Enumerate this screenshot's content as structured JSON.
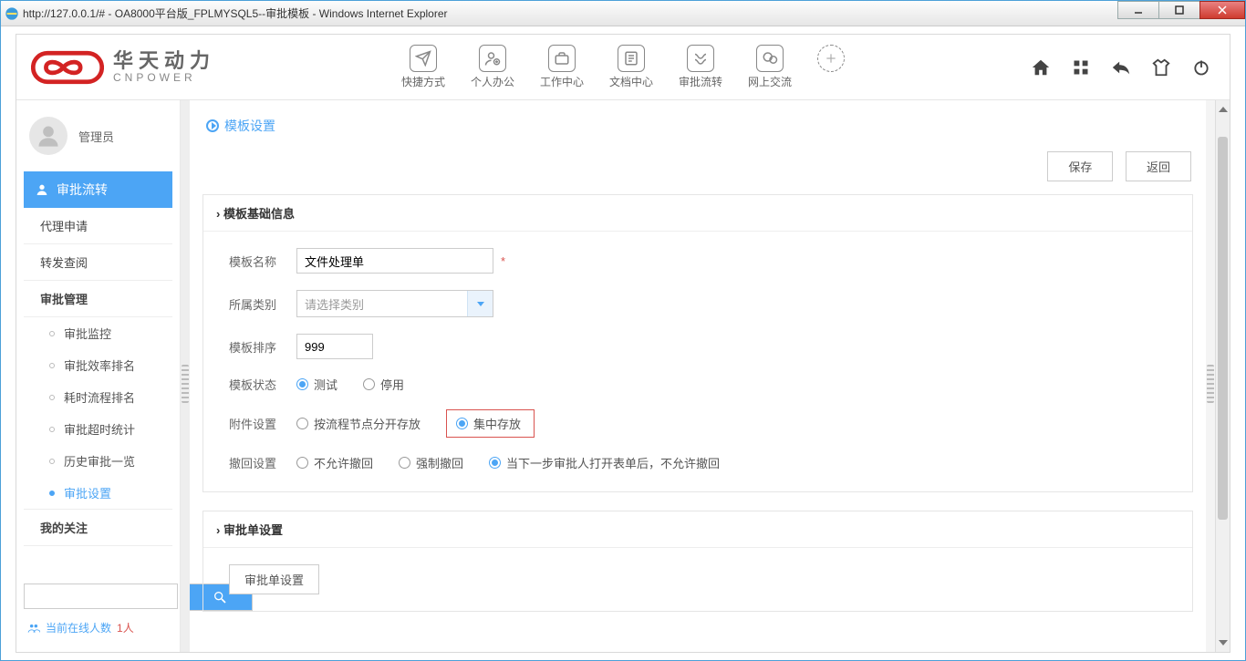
{
  "window": {
    "title": "http://127.0.0.1/# - OA8000平台版_FPLMYSQL5--审批模板 - Windows Internet Explorer"
  },
  "brand": {
    "name_cn": "华天动力",
    "name_en": "CNPOWER"
  },
  "nav_center": [
    {
      "label": "快捷方式"
    },
    {
      "label": "个人办公"
    },
    {
      "label": "工作中心"
    },
    {
      "label": "文档中心"
    },
    {
      "label": "审批流转"
    },
    {
      "label": "网上交流"
    }
  ],
  "user": {
    "name": "管理员"
  },
  "sidebar": {
    "module": "审批流转",
    "items": [
      {
        "label": "代理申请"
      },
      {
        "label": "转发查阅"
      },
      {
        "label": "审批管理"
      }
    ],
    "sub_items": [
      {
        "label": "审批监控"
      },
      {
        "label": "审批效率排名"
      },
      {
        "label": "耗时流程排名"
      },
      {
        "label": "审批超时统计"
      },
      {
        "label": "历史审批一览"
      },
      {
        "label": "审批设置",
        "active": true
      }
    ],
    "my_follow": "我的关注",
    "online_label": "当前在线人数",
    "online_count": "1人"
  },
  "page": {
    "title": "模板设置",
    "actions": {
      "save": "保存",
      "back": "返回"
    }
  },
  "panel1": {
    "title": "模板基础信息",
    "fields": {
      "name_label": "模板名称",
      "name_value": "文件处理单",
      "category_label": "所属类别",
      "category_placeholder": "请选择类别",
      "order_label": "模板排序",
      "order_value": "999",
      "status_label": "模板状态",
      "status_options": {
        "test": "测试",
        "disable": "停用"
      },
      "attach_label": "附件设置",
      "attach_options": {
        "split": "按流程节点分开存放",
        "central": "集中存放"
      },
      "revoke_label": "撤回设置",
      "revoke_options": {
        "forbid": "不允许撤回",
        "force": "强制撤回",
        "after_open": "当下一步审批人打开表单后，不允许撤回"
      }
    }
  },
  "panel2": {
    "title": "审批单设置",
    "button": "审批单设置"
  }
}
